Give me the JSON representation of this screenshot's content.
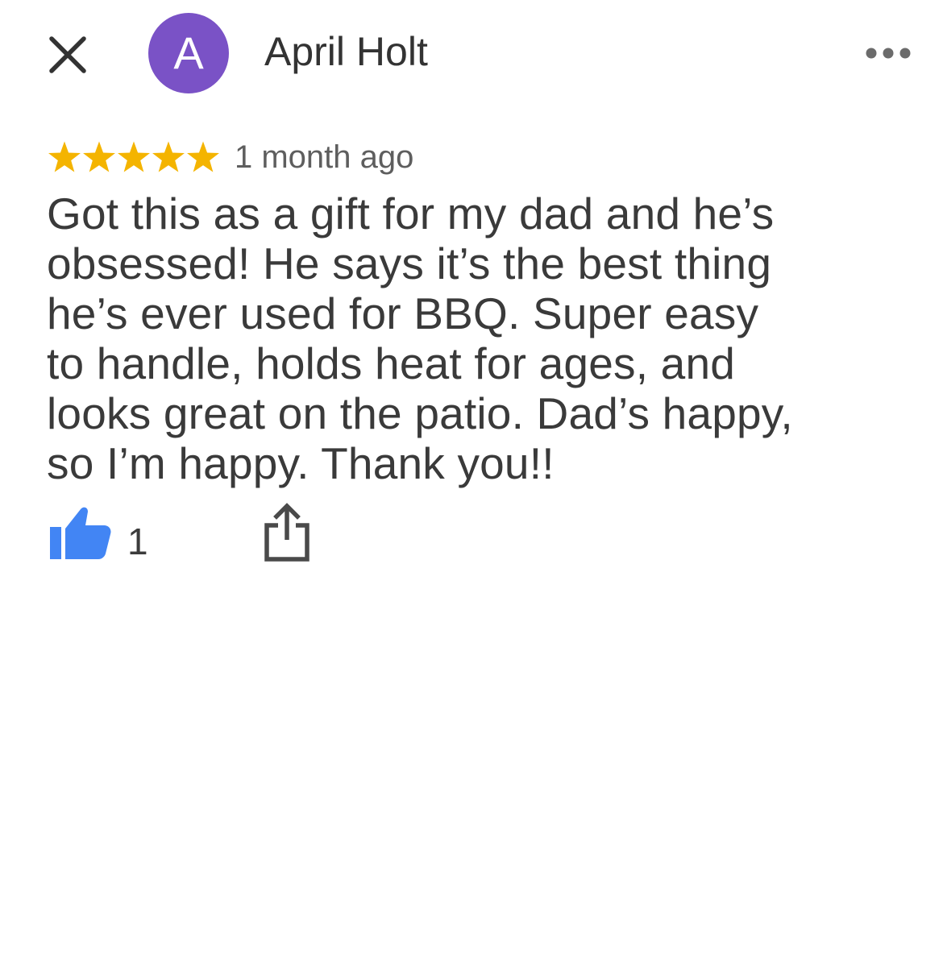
{
  "header": {
    "close_icon": "close-icon",
    "avatar_letter": "A",
    "avatar_color": "#7a52c6",
    "author_name": "April Holt",
    "more_icon": "more-horizontal-icon"
  },
  "review": {
    "rating": 5,
    "rating_max": 5,
    "star_color": "#f4b400",
    "timestamp": "1 month ago",
    "text_lines": [
      "Got this as a gift for my dad and he’s",
      "obsessed! He says it’s the best thing",
      "he’s ever used for BBQ. Super easy",
      "to handle, holds heat for ages, and",
      "looks great on the patio. Dad’s happy,",
      "so I’m happy. Thank you!!"
    ]
  },
  "actions": {
    "like_icon": "thumbs-up-icon",
    "like_color": "#4285f4",
    "like_count": "1",
    "share_icon": "share-icon"
  }
}
